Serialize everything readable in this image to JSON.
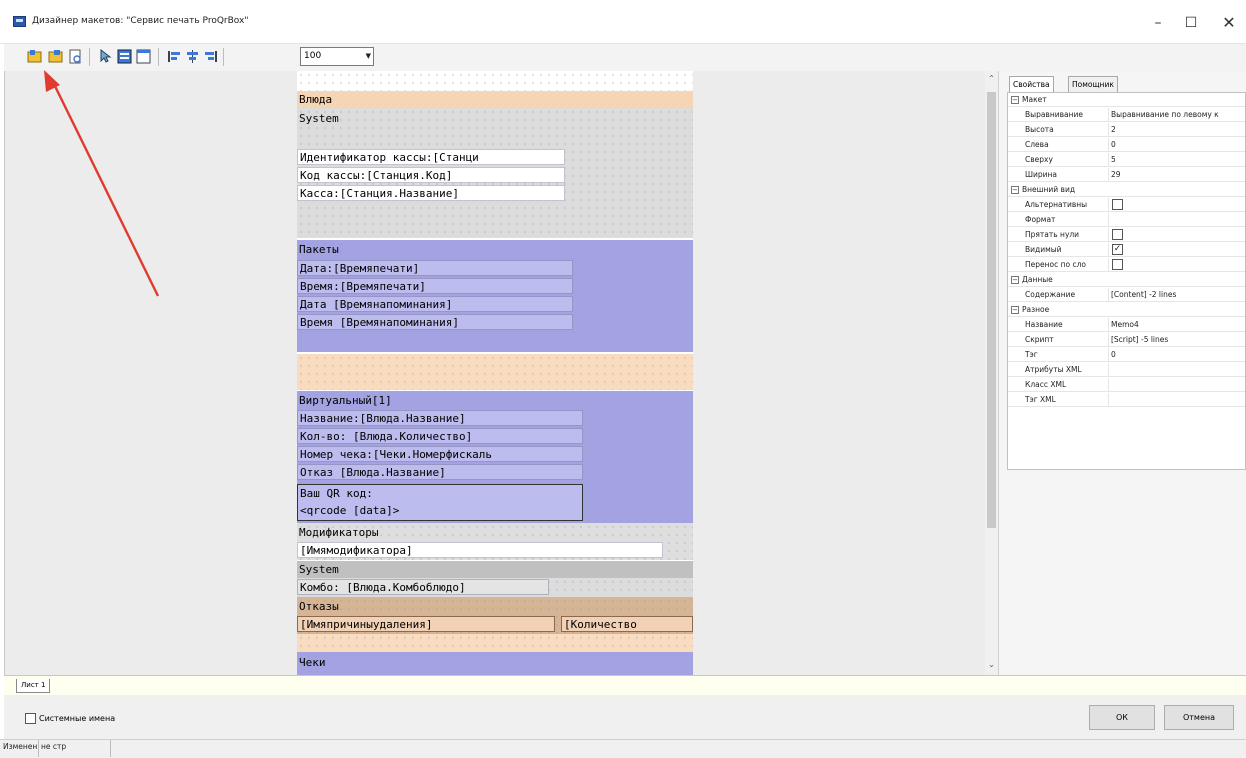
{
  "window": {
    "title": "Дизайнер макетов: \"Сервис печать ProQrBox\"",
    "minimize_icon": "minimize-icon",
    "maximize_icon": "maximize-icon",
    "close_icon": "close-icon"
  },
  "toolbar": {
    "zoom_value": "100",
    "icons": [
      "new-page-icon",
      "new-dialog-icon",
      "preview-icon",
      "select-pointer-icon",
      "band-icon",
      "page-icon",
      "align-left-icon",
      "align-center-icon",
      "align-right-icon"
    ]
  },
  "report": {
    "bands": [
      {
        "caption": "Влюда",
        "color": "#f6d5b4"
      },
      {
        "caption": "System",
        "color": "#dcdcdc"
      },
      {
        "caption": "Пакеты",
        "color": "#a9a9e6"
      },
      {
        "caption": "Виртуальный[1]",
        "color": "#a9a9e6"
      },
      {
        "caption": "Модификаторы",
        "color": "#dcdcdc"
      },
      {
        "caption": "System",
        "color": "#c4c4c4"
      },
      {
        "caption": "Отказы",
        "color": "#d8b79a"
      },
      {
        "caption": "Чеки",
        "color": "#a9a9e6"
      }
    ],
    "system_fields": [
      "Идентификатор кассы:[Станци",
      "Код кассы:[Станция.Код]",
      "Касса:[Станция.Название]"
    ],
    "packets_fields": [
      "Дата:[Времяпечати]",
      "Время:[Времяпечати]",
      "Дата [Времянапоминания]",
      "Время [Времянапоминания]"
    ],
    "virtual_fields": [
      "Название:[Влюда.Название]",
      "Кол-во: [Влюда.Количество]",
      "Номер чека:[Чеки.Номерфискаль",
      "Отказ [Влюда.Название]"
    ],
    "qr_lines": [
      "Ваш QR код:",
      "<qrcode [data]>"
    ],
    "modifier_field": "[Имямодификатора]",
    "combo_field": "Комбо: [Влюда.Комбоблюдо]",
    "refusal_field_1": "[Имяпричиныудаления]",
    "refusal_field_2": "[Количество"
  },
  "properties": {
    "tab_properties": "Свойства",
    "tab_helper": "Помощник",
    "rows": [
      {
        "kind": "cat",
        "name": "Макет"
      },
      {
        "kind": "prop",
        "name": "Выравнивание",
        "value": "Выравнивание по левому к"
      },
      {
        "kind": "prop",
        "name": "Высота",
        "value": "2"
      },
      {
        "kind": "prop",
        "name": "Слева",
        "value": "0"
      },
      {
        "kind": "prop",
        "name": "Сверху",
        "value": "5"
      },
      {
        "kind": "prop",
        "name": "Ширина",
        "value": "29"
      },
      {
        "kind": "cat",
        "name": "Внешний вид"
      },
      {
        "kind": "check",
        "name": "Альтернативны",
        "checked": false
      },
      {
        "kind": "prop",
        "name": "Формат",
        "value": ""
      },
      {
        "kind": "check",
        "name": "Прятать нули",
        "checked": false
      },
      {
        "kind": "check",
        "name": "Видимый",
        "checked": true
      },
      {
        "kind": "check",
        "name": "Перенос по сло",
        "checked": false
      },
      {
        "kind": "cat",
        "name": "Данные"
      },
      {
        "kind": "prop",
        "name": "Содержание",
        "value": "[Content] -2 lines"
      },
      {
        "kind": "cat",
        "name": "Разное"
      },
      {
        "kind": "prop",
        "name": "Название",
        "value": "Memo4"
      },
      {
        "kind": "prop",
        "name": "Скрипт",
        "value": "[Script] -5 lines"
      },
      {
        "kind": "prop",
        "name": "Тэг",
        "value": "0"
      },
      {
        "kind": "prop",
        "name": "Атрибуты XML",
        "value": ""
      },
      {
        "kind": "prop",
        "name": "Класс XML",
        "value": ""
      },
      {
        "kind": "prop",
        "name": "Тэг XML",
        "value": ""
      }
    ]
  },
  "sheet_tab": "Лист 1",
  "system_names_label": "Системные имена",
  "ok_label": "ОК",
  "cancel_label": "Отмена",
  "status": {
    "left": "Изменен",
    "right": "не стр"
  },
  "colors": {
    "arrow": "#e03b2f"
  }
}
